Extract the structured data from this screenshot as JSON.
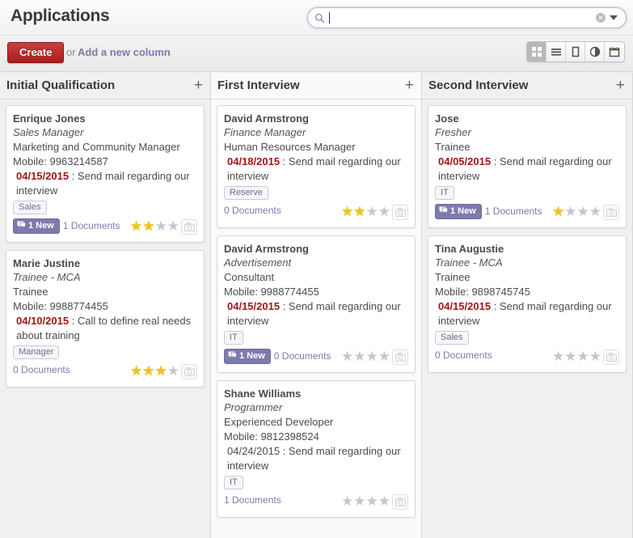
{
  "header": {
    "title": "Applications",
    "search": {
      "value": "",
      "placeholder": "",
      "icon": "search-icon",
      "clear": "✕"
    }
  },
  "toolbar": {
    "create_label": "Create",
    "or_label": "or",
    "add_column_label": "Add a new column",
    "views": [
      {
        "name": "kanban-view",
        "icon": "grid-icon",
        "active": true
      },
      {
        "name": "list-view",
        "icon": "list-icon",
        "active": false
      },
      {
        "name": "form-view",
        "icon": "form-icon",
        "active": false
      },
      {
        "name": "graph-view",
        "icon": "pie-chart-icon",
        "active": false
      },
      {
        "name": "calendar-view",
        "icon": "calendar-icon",
        "active": false
      }
    ]
  },
  "columns": [
    {
      "title": "Initial Qualification",
      "add_icon": "+",
      "cards": [
        {
          "name": "Enrique Jones",
          "subtitle": "Sales Manager",
          "job": "Marketing and Community Manager",
          "mobile": "Mobile: 9963214587",
          "date": "04/15/2015",
          "date_overdue": true,
          "message": " : Send mail regarding our interview",
          "tag": "Sales",
          "new_badge": "1 New",
          "documents": "1 Documents",
          "stars_filled": 2,
          "stars_total": 4
        },
        {
          "name": "Marie Justine",
          "subtitle": "Trainee - MCA",
          "job": "Trainee",
          "mobile": "Mobile: 9988774455",
          "date": "04/10/2015",
          "date_overdue": true,
          "message": " : Call to define real needs about training",
          "tag": "Manager",
          "new_badge": null,
          "documents": "0 Documents",
          "stars_filled": 3,
          "stars_total": 4
        }
      ]
    },
    {
      "title": "First Interview",
      "add_icon": "+",
      "cards": [
        {
          "name": "David Armstrong",
          "subtitle": "Finance Manager",
          "job": "Human Resources Manager",
          "mobile": null,
          "date": "04/18/2015",
          "date_overdue": true,
          "message": " : Send mail regarding our interview",
          "tag": "Reserve",
          "new_badge": null,
          "documents": "0 Documents",
          "stars_filled": 2,
          "stars_total": 4
        },
        {
          "name": "David Armstrong",
          "subtitle": "Advertisement",
          "job": "Consultant",
          "mobile": "Mobile: 9988774455",
          "date": "04/15/2015",
          "date_overdue": true,
          "message": " : Send mail regarding our interview",
          "tag": "IT",
          "new_badge": "1 New",
          "documents": "0 Documents",
          "stars_filled": 0,
          "stars_total": 4
        },
        {
          "name": "Shane Williams",
          "subtitle": "Programmer",
          "job": "Experienced Developer",
          "mobile": "Mobile: 9812398524",
          "date": "04/24/2015",
          "date_overdue": false,
          "message": " : Send mail regarding our interview",
          "tag": "IT",
          "new_badge": null,
          "documents": "1 Documents",
          "stars_filled": 0,
          "stars_total": 4
        }
      ]
    },
    {
      "title": "Second Interview",
      "add_icon": "+",
      "cards": [
        {
          "name": "Jose",
          "subtitle": "Fresher",
          "job": "Trainee",
          "mobile": null,
          "date": "04/05/2015",
          "date_overdue": true,
          "message": " : Send mail regarding our interview",
          "tag": "IT",
          "new_badge": "1 New",
          "documents": "1 Documents",
          "stars_filled": 1,
          "stars_total": 4
        },
        {
          "name": "Tina Augustie",
          "subtitle": "Trainee - MCA",
          "job": "Trainee",
          "mobile": "Mobile: 9898745745",
          "date": "04/15/2015",
          "date_overdue": true,
          "message": " : Send mail regarding our interview",
          "tag": "Sales",
          "new_badge": null,
          "documents": "0 Documents",
          "stars_filled": 0,
          "stars_total": 4
        }
      ]
    }
  ],
  "colors": {
    "accent": "#7c7bad",
    "create_button": "#a81c1c",
    "overdue_date": "#a31515",
    "star_on": "#f0c419",
    "star_off": "#c5c5cf"
  }
}
